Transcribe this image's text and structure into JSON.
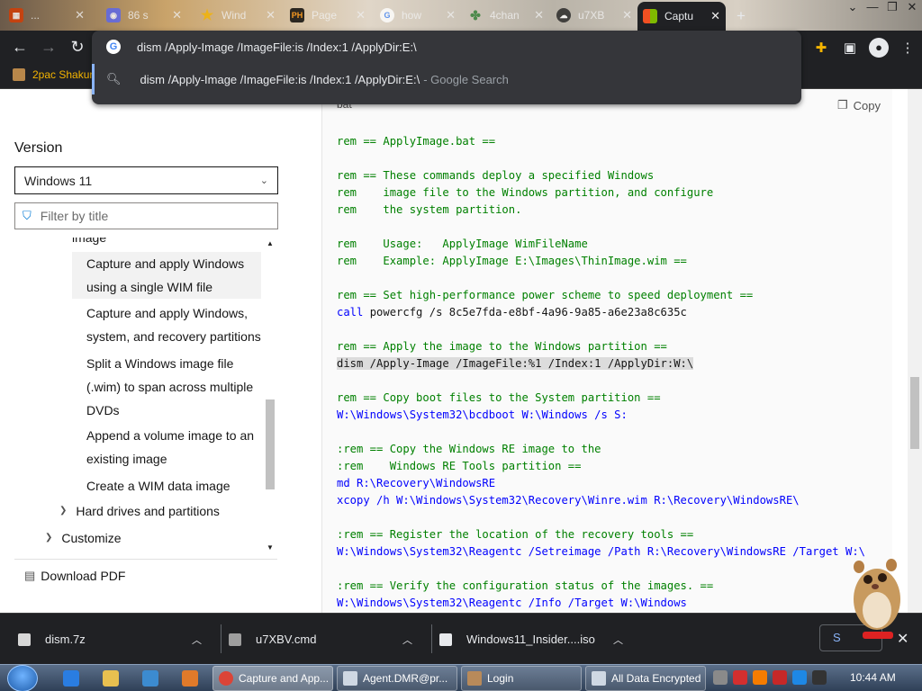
{
  "browser": {
    "tabs": [
      {
        "title": "...",
        "icon": "windows-logo-icon"
      },
      {
        "title": "86 s",
        "icon": "discord-icon"
      },
      {
        "title": "Wind",
        "icon": "star-icon"
      },
      {
        "title": "Page",
        "icon": "ph-icon"
      },
      {
        "title": "how",
        "icon": "google-icon"
      },
      {
        "title": "4chan",
        "icon": "clover-icon"
      },
      {
        "title": "u7XB",
        "icon": "cloud-icon"
      },
      {
        "title": "Captu",
        "icon": "microsoft-icon",
        "active": true
      }
    ],
    "new_tab": "+",
    "window_controls": [
      "⌄",
      "—",
      "❐",
      "✕"
    ],
    "omnibox": {
      "value": "dism /Apply-Image /ImageFile:is /Index:1 /ApplyDir:E:\\",
      "suggestion": "dism /Apply-Image /ImageFile:is /Index:1 /ApplyDir:E:\\",
      "suggestion_suffix": "- Google Search"
    },
    "bookmark": "2pac Shakur"
  },
  "sidebar": {
    "version_label": "Version",
    "version_value": "Windows 11",
    "filter_placeholder": "Filter by title",
    "toc_partial": "image",
    "toc": [
      {
        "label": "Capture and apply Windows using a single WIM file",
        "lines": [
          "Capture and apply Windows",
          "using a single WIM file"
        ],
        "selected": true
      },
      {
        "label": "Capture and apply Windows, system, and recovery partitions",
        "lines": [
          "Capture and apply Windows,",
          "system, and recovery partitions"
        ]
      },
      {
        "label": "Split a Windows image file (.wim) to span across multiple DVDs",
        "lines": [
          "Split a Windows image file",
          "(.wim) to span across multiple",
          "DVDs"
        ]
      },
      {
        "label": "Append a volume image to an existing image",
        "lines": [
          "Append a volume image to an",
          "existing image"
        ]
      },
      {
        "label": "Create a WIM data image",
        "lines": [
          "Create a WIM data image"
        ]
      }
    ],
    "sections": [
      "Hard drives and partitions",
      "Customize"
    ],
    "download": "Download PDF"
  },
  "code": {
    "language": "bat",
    "copy_label": "Copy",
    "lines": [
      "rem == ApplyImage.bat ==",
      "",
      "rem == These commands deploy a specified Windows",
      "rem    image file to the Windows partition, and configure",
      "rem    the system partition.",
      "",
      "rem    Usage:   ApplyImage WimFileName",
      "rem    Example: ApplyImage E:\\Images\\ThinImage.wim ==",
      "",
      "rem == Set high-performance power scheme to speed deployment ==",
      "call powercfg /s 8c5e7fda-e8bf-4a96-9a85-a6e23a8c635c",
      "",
      "rem == Apply the image to the Windows partition ==",
      "dism /Apply-Image /ImageFile:%1 /Index:1 /ApplyDir:W:\\",
      "",
      "rem == Copy boot files to the System partition ==",
      "W:\\Windows\\System32\\bcdboot W:\\Windows /s S:",
      "",
      ":rem == Copy the Windows RE image to the",
      ":rem    Windows RE Tools partition ==",
      "md R:\\Recovery\\WindowsRE",
      "xcopy /h W:\\Windows\\System32\\Recovery\\Winre.wim R:\\Recovery\\WindowsRE\\",
      "",
      ":rem == Register the location of the recovery tools ==",
      "W:\\Windows\\System32\\Reagentc /Setreimage /Path R:\\Recovery\\WindowsRE /Target W:\\",
      "",
      ":rem == Verify the configuration status of the images. ==",
      "W:\\Windows\\System32\\Reagentc /Info /Target W:\\Windows"
    ]
  },
  "downloads": {
    "items": [
      "dism.7z",
      "u7XBV.cmd",
      "Windows11_Insider....iso"
    ],
    "show_all": "S"
  },
  "taskbar": {
    "windows": [
      {
        "label": "Capture and App...",
        "active": true
      },
      {
        "label": "Agent.DMR@pr..."
      },
      {
        "label": "Login"
      },
      {
        "label": "All Data Encrypted"
      }
    ],
    "clock": "10:44 AM"
  }
}
